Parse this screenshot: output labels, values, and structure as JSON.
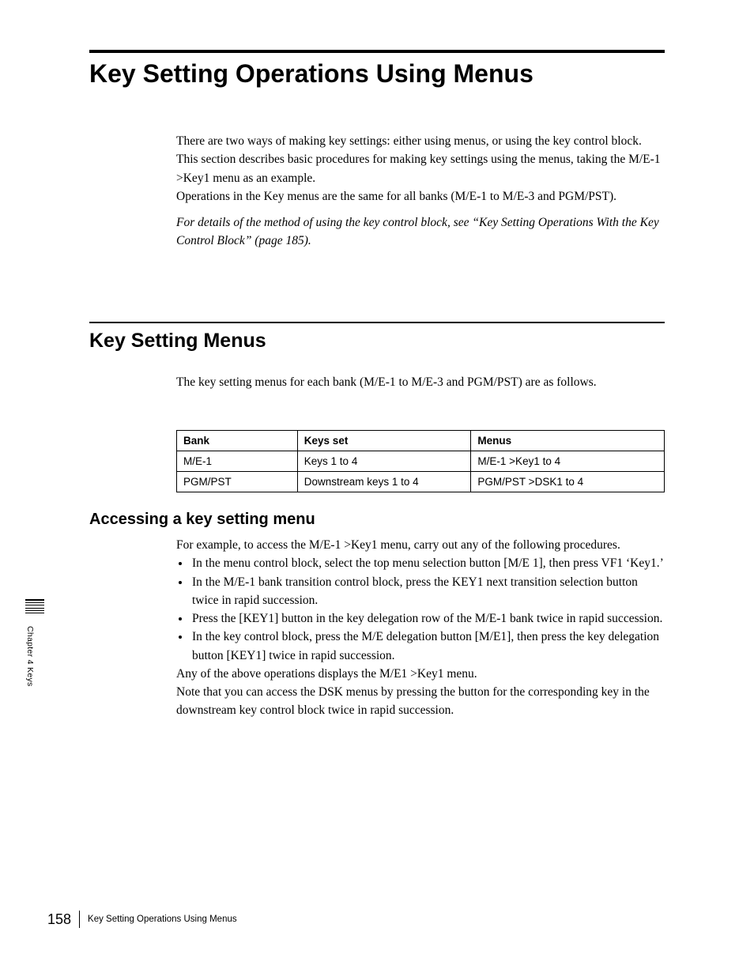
{
  "title": "Key Setting Operations Using Menus",
  "intro": {
    "p1": "There are two ways of making key settings: either using menus, or using the key control block.",
    "p2": "This section describes basic procedures for making key settings using the menus, taking the M/E-1 >Key1 menu as an example.",
    "p3": "Operations in the Key menus are the same for all banks (M/E-1 to M/E-3 and PGM/PST).",
    "ref": "For details of the method of using the key control block, see “Key Setting Operations With the Key Control Block” (page 185)."
  },
  "section2": {
    "heading": "Key Setting Menus",
    "lead": "The key setting menus for each bank (M/E-1 to M/E-3 and PGM/PST) are as follows."
  },
  "table": {
    "head": [
      "Bank",
      "Keys set",
      "Menus"
    ],
    "rows": [
      [
        "M/E-1",
        "Keys 1 to 4",
        "M/E-1 >Key1 to 4"
      ],
      [
        "PGM/PST",
        "Downstream keys 1 to 4",
        "PGM/PST >DSK1 to 4"
      ]
    ]
  },
  "section3": {
    "heading": "Accessing a key setting menu",
    "lead": "For example, to access the M/E-1 >Key1 menu, carry out any of the following procedures.",
    "bullets": [
      "In the menu control block, select the top menu selection button [M/E 1], then press VF1 ‘Key1.’",
      "In the M/E-1 bank transition control block, press the KEY1 next transition selection button twice in rapid succession.",
      "Press the [KEY1] button in the key delegation row of the M/E-1 bank twice in rapid succession.",
      "In the key control block, press the M/E delegation button [M/E1], then press the key delegation button [KEY1] twice in rapid succession."
    ],
    "tail1": "Any of the above operations displays the M/E1 >Key1 menu.",
    "tail2": "Note that you can access the DSK menus by pressing the button for the corresponding key in the downstream key control block twice in rapid succession."
  },
  "side_label": "Chapter 4  Keys",
  "footer": {
    "page": "158",
    "title": "Key Setting Operations Using Menus"
  }
}
